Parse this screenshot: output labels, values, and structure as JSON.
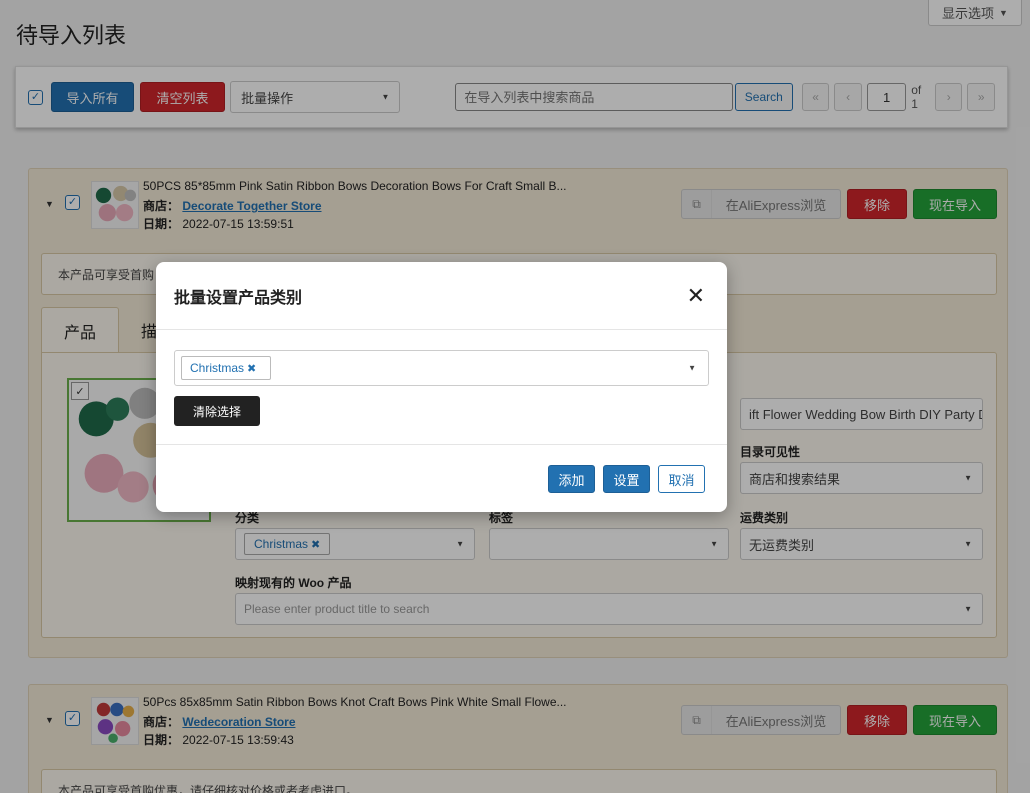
{
  "header": {
    "title": "待导入列表",
    "display_options": "显示选项"
  },
  "toolbar": {
    "import_all": "导入所有",
    "clear_list": "清空列表",
    "bulk_action": "批量操作",
    "search_placeholder": "在导入列表中搜索商品",
    "search_button": "Search",
    "pagination": {
      "first": "«",
      "prev": "‹",
      "current_page": "1",
      "of_label": "of 1",
      "next": "›",
      "last": "»"
    }
  },
  "products": [
    {
      "title": "50PCS 85*85mm Pink Satin Ribbon Bows Decoration Bows For Craft Small B...",
      "store_label": "商店：",
      "store_name": "Decorate Together Store",
      "date_label": "日期：",
      "date": "2022-07-15 13:59:51",
      "view_button": "在AliExpress浏览",
      "remove_button": "移除",
      "import_button": "现在导入",
      "notice": "本产品可享受首购",
      "tabs": [
        "产品",
        "描"
      ],
      "title_field_value": "ift Flower Wedding Bow Birth DIY Party Dec",
      "visibility_label": "目录可见性",
      "visibility_value": "商店和搜索结果",
      "category_label": "分类",
      "category_tag": "Christmas",
      "tags_label": "标签",
      "shipping_label": "运费类别",
      "shipping_value": "无运费类别",
      "map_label": "映射现有的 Woo 产品",
      "map_placeholder": "Please enter product title to search"
    },
    {
      "title": "50Pcs 85x85mm Satin Ribbon Bows Knot Craft Bows Pink White Small Flowe...",
      "store_label": "商店：",
      "store_name": "Wedecoration Store",
      "date_label": "日期：",
      "date": "2022-07-15 13:59:43",
      "view_button": "在AliExpress浏览",
      "remove_button": "移除",
      "import_button": "现在导入",
      "notice": "本产品可享受首购优惠，请仔细核对价格或者考虑进口。"
    }
  ],
  "modal": {
    "title": "批量设置产品类别",
    "close": "✕",
    "selected_tag": "Christmas",
    "clear_button": "清除选择",
    "add_button": "添加",
    "set_button": "设置",
    "cancel_button": "取消"
  },
  "icons": {
    "checkbox": "check-icon",
    "dropdown": "caret-down-icon",
    "external": "external-link-icon",
    "close": "close-icon"
  },
  "colors": {
    "primary": "#2271b1",
    "danger": "#d0262b",
    "success": "#24a33a",
    "card_bg": "#f3ead8"
  }
}
